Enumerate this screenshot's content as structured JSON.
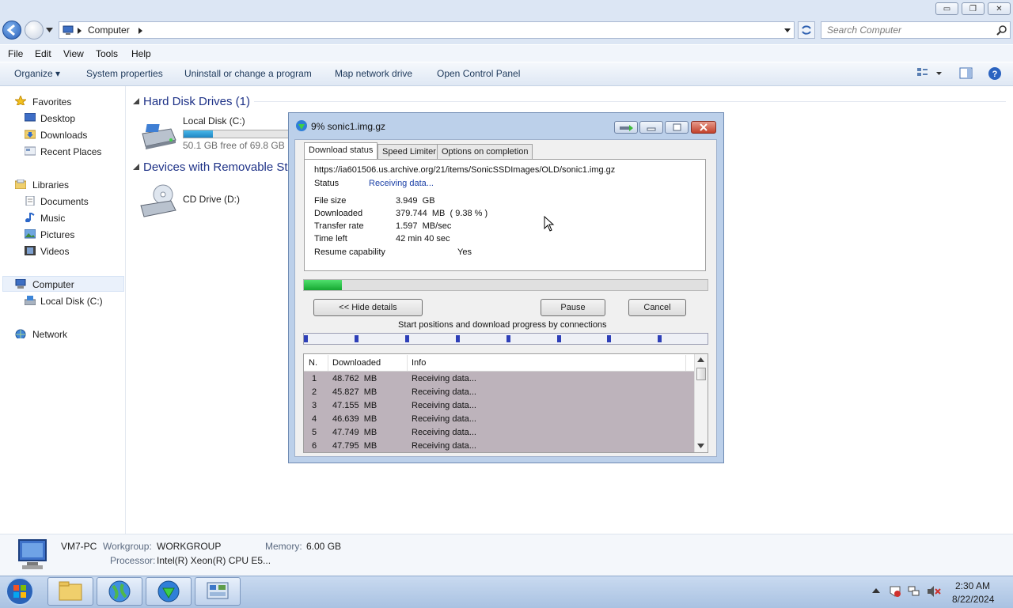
{
  "window": {
    "minimize_glyph": "▭",
    "restore_glyph": "❐",
    "close_glyph": "✕"
  },
  "address": {
    "path": "Computer",
    "search_placeholder": "Search Computer"
  },
  "menubar": [
    "File",
    "Edit",
    "View",
    "Tools",
    "Help"
  ],
  "commandbar": {
    "organize": "Organize ▾",
    "system_properties": "System properties",
    "uninstall": "Uninstall or change a program",
    "map_drive": "Map network drive",
    "control_panel": "Open Control Panel"
  },
  "navpane": {
    "favorites": "Favorites",
    "desktop": "Desktop",
    "downloads": "Downloads",
    "recent": "Recent Places",
    "libraries": "Libraries",
    "documents": "Documents",
    "music": "Music",
    "pictures": "Pictures",
    "videos": "Videos",
    "computer": "Computer",
    "local_disk": "Local Disk (C:)",
    "network": "Network"
  },
  "content": {
    "hdd_group": "Hard Disk Drives (1)",
    "removable_group": "Devices with Removable Sto",
    "local_disk_name": "Local Disk (C:)",
    "local_disk_free": "50.1 GB free of 69.8 GB",
    "local_disk_used_fraction": 0.28,
    "cd_drive_name": "CD Drive (D:)"
  },
  "details": {
    "pc_name": "VM7-PC",
    "workgroup_label": "Workgroup:",
    "workgroup_value": "WORKGROUP",
    "memory_label": "Memory:",
    "memory_value": "6.00 GB",
    "processor_label": "Processor:",
    "processor_value": "Intel(R) Xeon(R) CPU E5..."
  },
  "taskbar": {
    "time": "2:30 AM",
    "date": "8/22/2024"
  },
  "dialog": {
    "title": "9% sonic1.img.gz",
    "tabs": [
      "Download status",
      "Speed Limiter",
      "Options on completion"
    ],
    "url": "https://ia601506.us.archive.org/21/items/SonicSSDImages/OLD/sonic1.img.gz",
    "status_label": "Status",
    "status_value": "Receiving data...",
    "file_size_label": "File size",
    "file_size_value": "3.949  GB",
    "downloaded_label": "Downloaded",
    "downloaded_value": "379.744  MB  ( 9.38 % )",
    "transfer_rate_label": "Transfer rate",
    "transfer_rate_value": "1.597  MB/sec",
    "time_left_label": "Time left",
    "time_left_value": "42 min 40 sec",
    "resume_label": "Resume capability",
    "resume_value": "Yes",
    "progress_fraction": 0.0938,
    "hide_details_button": "<< Hide details",
    "pause_button": "Pause",
    "cancel_button": "Cancel",
    "connections_caption": "Start positions and download progress by connections",
    "list_headers": [
      "N.",
      "Downloaded",
      "Info"
    ],
    "connections": [
      {
        "n": "1",
        "downloaded": "48.762  MB",
        "info": "Receiving data..."
      },
      {
        "n": "2",
        "downloaded": "45.827  MB",
        "info": "Receiving data..."
      },
      {
        "n": "3",
        "downloaded": "47.155  MB",
        "info": "Receiving data..."
      },
      {
        "n": "4",
        "downloaded": "46.639  MB",
        "info": "Receiving data..."
      },
      {
        "n": "5",
        "downloaded": "47.749  MB",
        "info": "Receiving data..."
      },
      {
        "n": "6",
        "downloaded": "47.795  MB",
        "info": "Receiving data..."
      }
    ]
  }
}
